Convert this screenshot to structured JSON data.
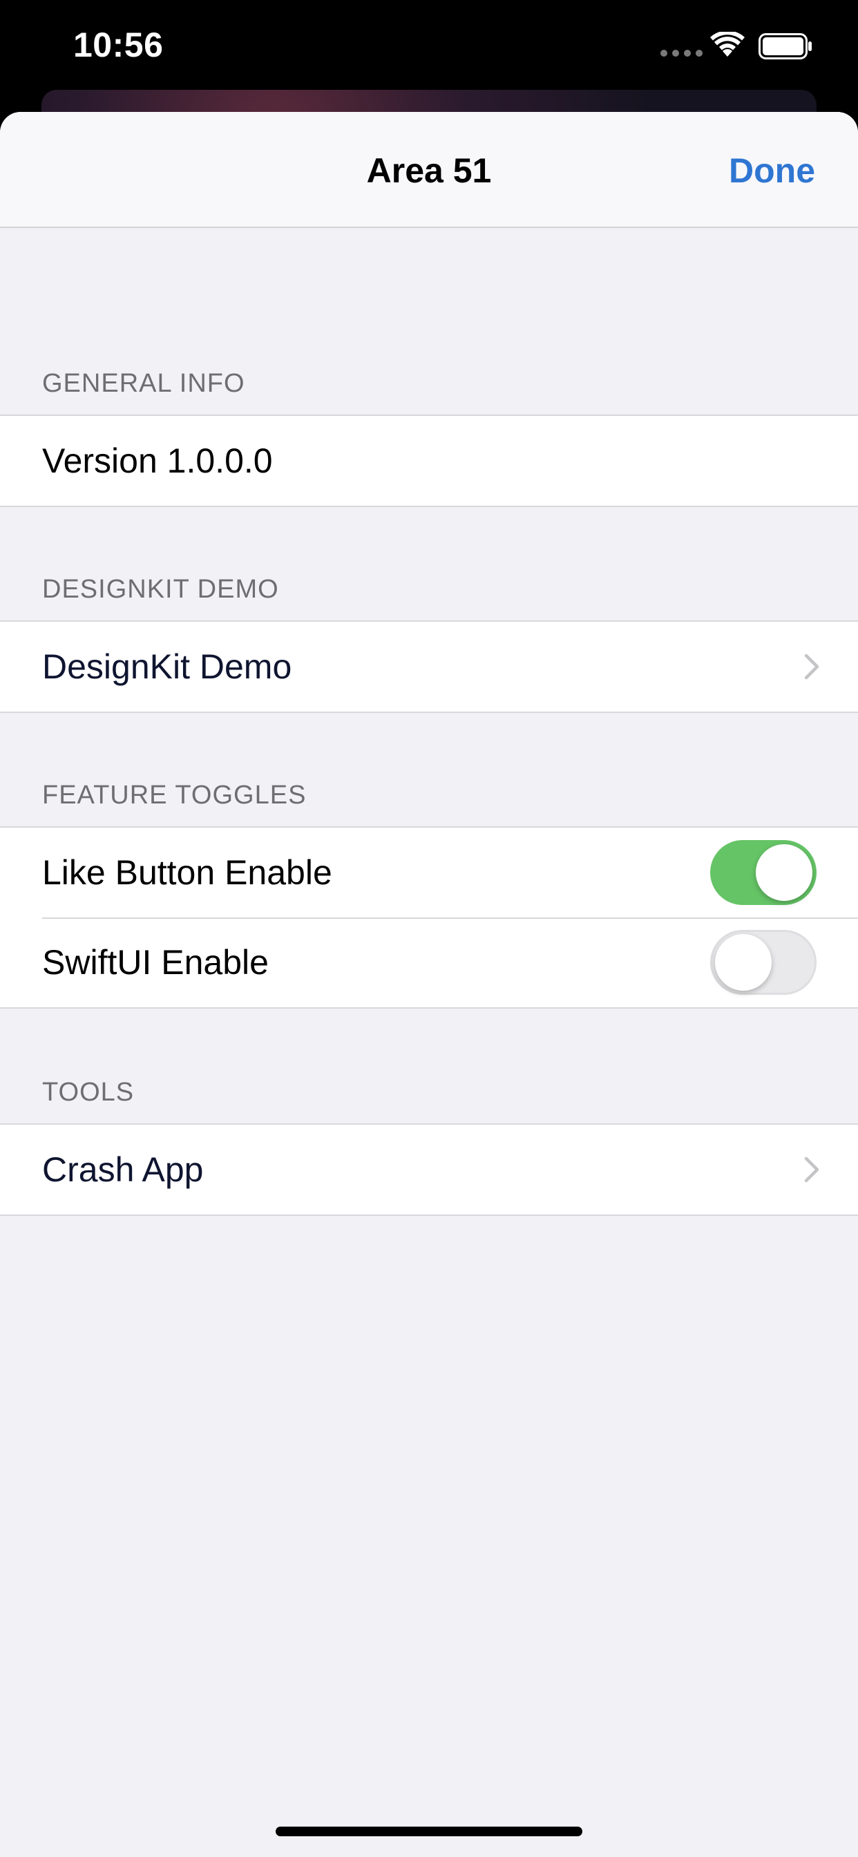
{
  "status_bar": {
    "time": "10:56"
  },
  "nav": {
    "title": "Area 51",
    "done_label": "Done"
  },
  "sections": {
    "general_info": {
      "header": "GENERAL INFO",
      "version_label": "Version 1.0.0.0"
    },
    "designkit": {
      "header": "DESIGNKIT DEMO",
      "item_label": "DesignKit Demo"
    },
    "feature_toggles": {
      "header": "FEATURE TOGGLES",
      "like_button_label": "Like Button Enable",
      "like_button_on": true,
      "swiftui_label": "SwiftUI Enable",
      "swiftui_on": false
    },
    "tools": {
      "header": "TOOLS",
      "crash_label": "Crash App"
    }
  },
  "colors": {
    "accent": "#2f76d2",
    "toggle_on": "#65c466",
    "background": "#f1f1f6"
  }
}
